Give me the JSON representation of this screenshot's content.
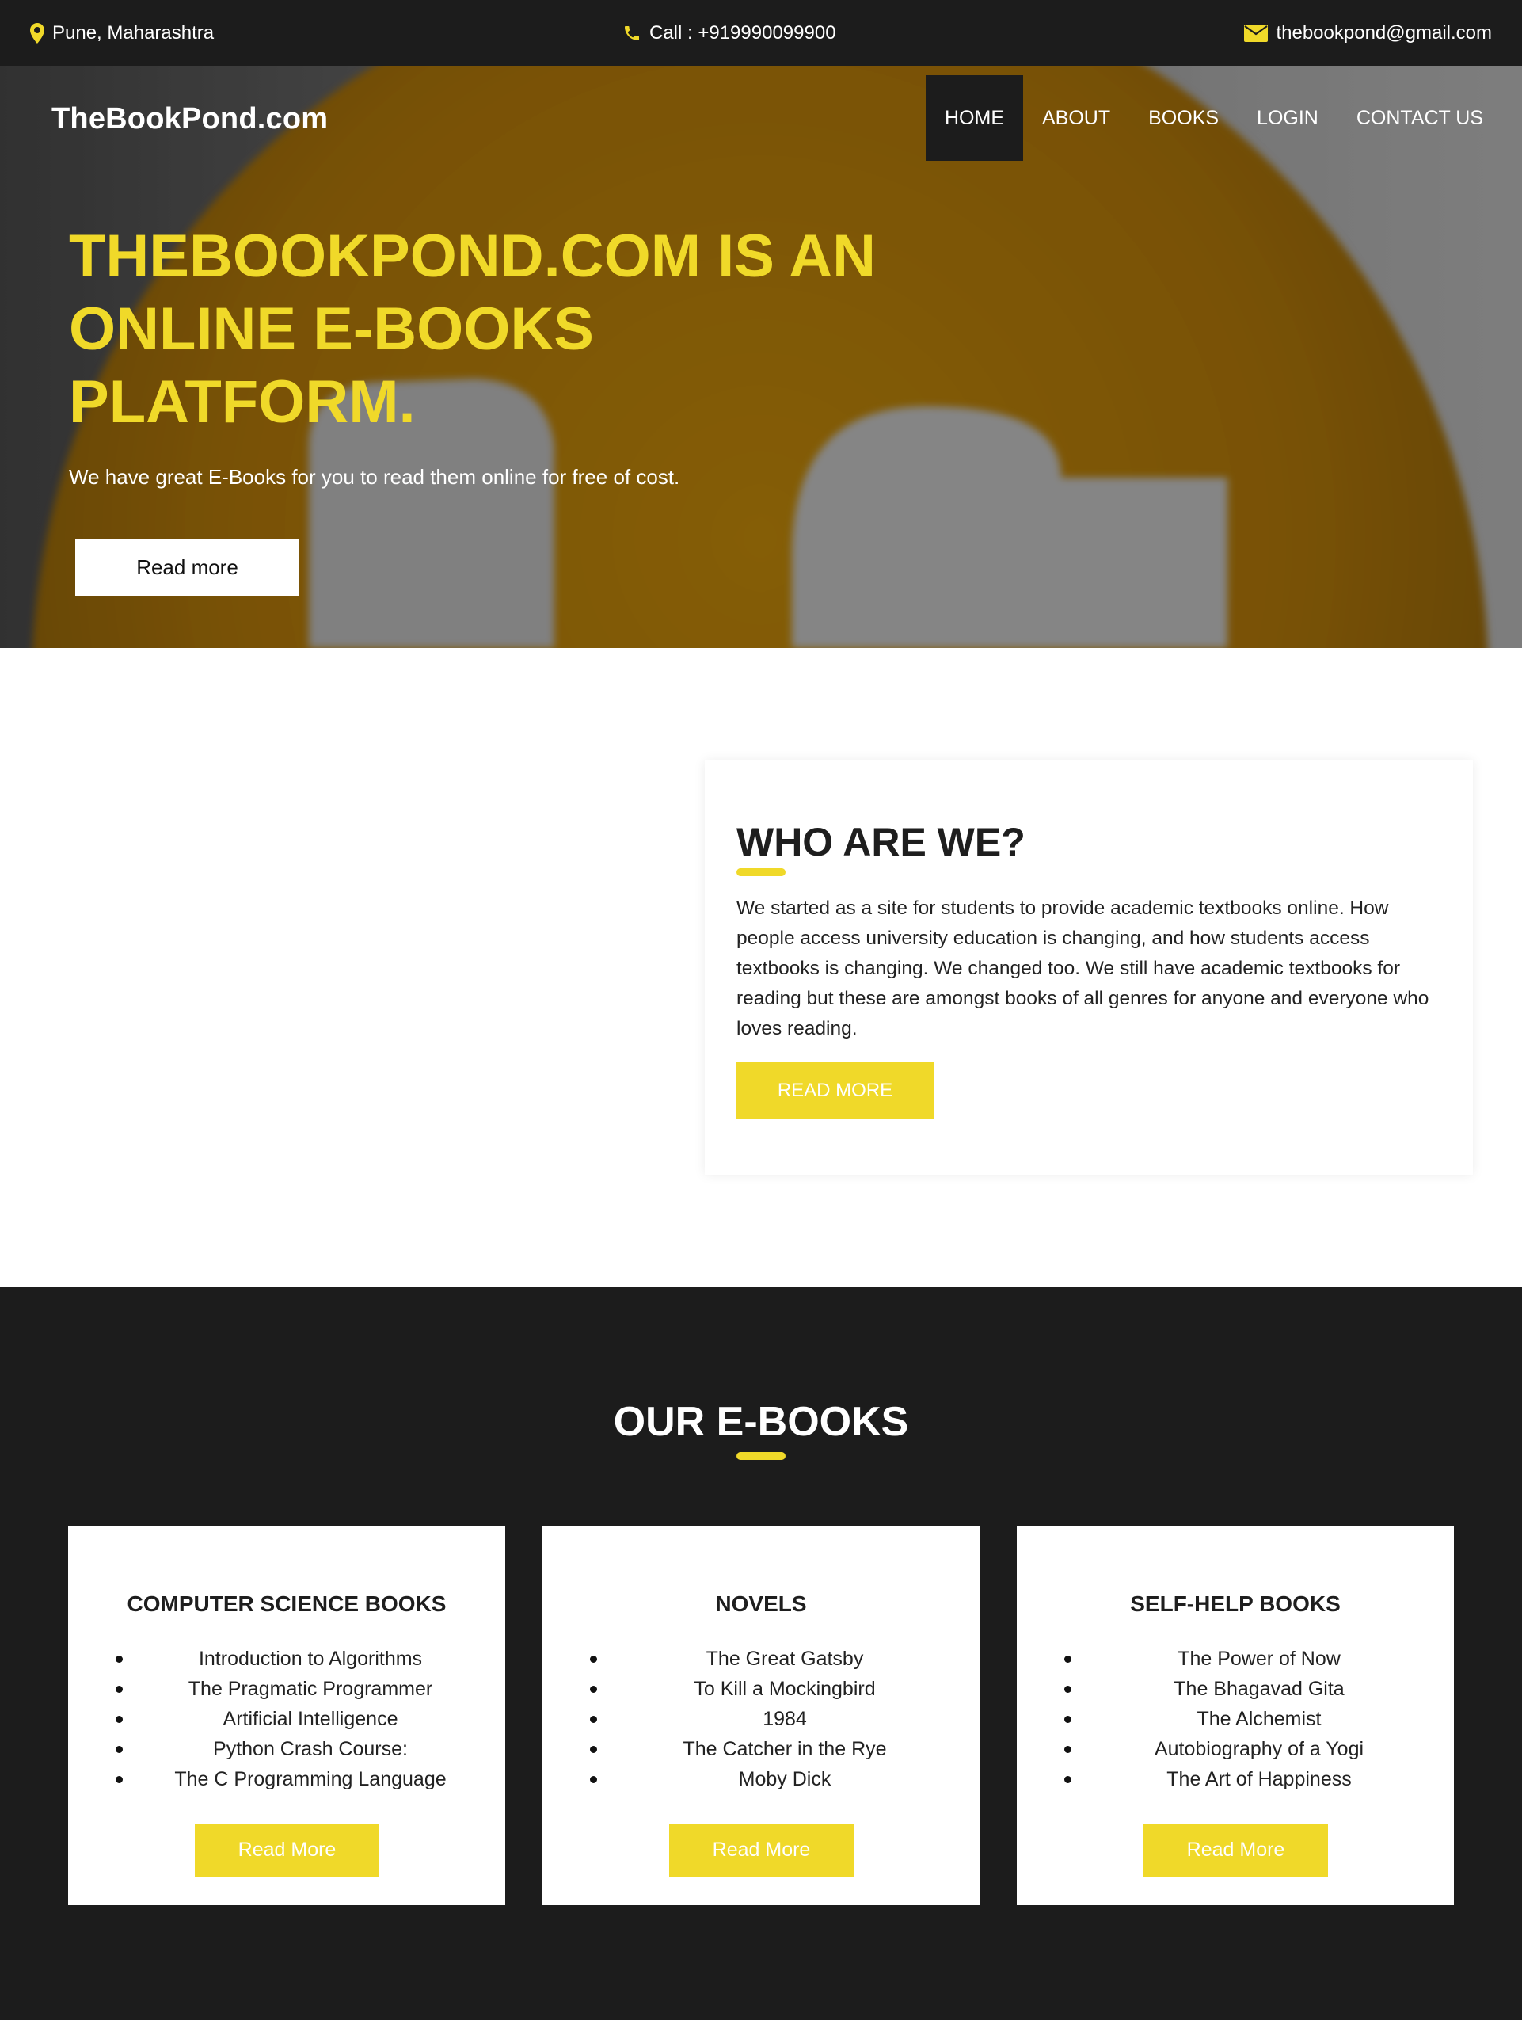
{
  "topbar": {
    "location": "Pune, Maharashtra",
    "call": "Call : +919990099900",
    "email": "thebookpond@gmail.com",
    "location_icon": "map-marker-icon",
    "call_icon": "phone-icon",
    "email_icon": "envelope-icon"
  },
  "header": {
    "brand": "TheBookPond.com",
    "nav": [
      {
        "label": "HOME"
      },
      {
        "label": "ABOUT"
      },
      {
        "label": "BOOKS"
      },
      {
        "label": "LOGIN"
      },
      {
        "label": "CONTACT US"
      }
    ],
    "active_nav": "HOME"
  },
  "hero": {
    "title": "THEBOOKPOND.COM IS AN ONLINE E-BOOKS PLATFORM.",
    "subtitle": "We have great E-Books for you to read them online for free of cost.",
    "button": "Read more"
  },
  "about": {
    "title": "WHO ARE WE?",
    "text": "We started as a site for students to provide academic textbooks online. How people access university education is changing, and how students access textbooks is changing. We changed too. We still have academic textbooks for reading but these are amongst books of all genres for anyone and everyone who loves reading.",
    "button": "READ MORE"
  },
  "ebooks": {
    "title": "OUR E-BOOKS",
    "cards": [
      {
        "title": "COMPUTER SCIENCE BOOKS",
        "items": [
          "Introduction to Algorithms",
          "The Pragmatic Programmer",
          "Artificial Intelligence",
          "Python Crash Course:",
          "The C Programming Language"
        ],
        "button": "Read More"
      },
      {
        "title": "NOVELS",
        "items": [
          "The Great Gatsby",
          "To Kill a Mockingbird",
          "1984",
          "The Catcher in the Rye",
          "Moby Dick"
        ],
        "button": "Read More"
      },
      {
        "title": "SELF-HELP BOOKS",
        "items": [
          "The Power of Now",
          "The Bhagavad Gita",
          "The Alchemist",
          "Autobiography of a Yogi",
          "The Art of Happiness"
        ],
        "button": "Read More"
      }
    ]
  },
  "colors": {
    "accent": "#f0d929",
    "dark": "#1c1c1c",
    "white": "#ffffff"
  }
}
